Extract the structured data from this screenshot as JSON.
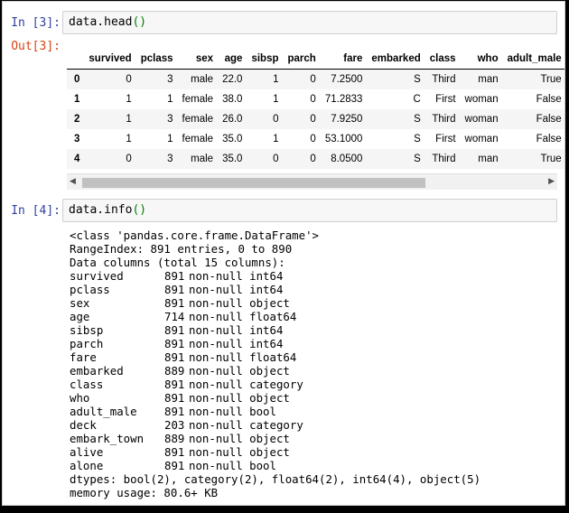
{
  "cells": [
    {
      "prompt_in": "In [3]:",
      "code": "data.head",
      "code_parens": "()",
      "prompt_out": "Out[3]:"
    },
    {
      "prompt_in": "In [4]:",
      "code": "data.info",
      "code_parens": "()"
    }
  ],
  "dataframe": {
    "columns": [
      "",
      "survived",
      "pclass",
      "sex",
      "age",
      "sibsp",
      "parch",
      "fare",
      "embarked",
      "class",
      "who",
      "adult_male"
    ],
    "rows": [
      [
        "0",
        "0",
        "3",
        "male",
        "22.0",
        "1",
        "0",
        "7.2500",
        "S",
        "Third",
        "man",
        "True"
      ],
      [
        "1",
        "1",
        "1",
        "female",
        "38.0",
        "1",
        "0",
        "71.2833",
        "C",
        "First",
        "woman",
        "False"
      ],
      [
        "2",
        "1",
        "3",
        "female",
        "26.0",
        "0",
        "0",
        "7.9250",
        "S",
        "Third",
        "woman",
        "False"
      ],
      [
        "3",
        "1",
        "1",
        "female",
        "35.0",
        "1",
        "0",
        "53.1000",
        "S",
        "First",
        "woman",
        "False"
      ],
      [
        "4",
        "0",
        "3",
        "male",
        "35.0",
        "0",
        "0",
        "8.0500",
        "S",
        "Third",
        "man",
        "True"
      ]
    ]
  },
  "scrollbar": {
    "left_arrow": "◀",
    "right_arrow": "▶"
  },
  "info_output": {
    "header": [
      "<class 'pandas.core.frame.DataFrame'>",
      "RangeIndex: 891 entries, 0 to 890",
      "Data columns (total 15 columns):"
    ],
    "columns": [
      {
        "name": "survived",
        "count": "891",
        "desc": "non-null int64"
      },
      {
        "name": "pclass",
        "count": "891",
        "desc": "non-null int64"
      },
      {
        "name": "sex",
        "count": "891",
        "desc": "non-null object"
      },
      {
        "name": "age",
        "count": "714",
        "desc": "non-null float64"
      },
      {
        "name": "sibsp",
        "count": "891",
        "desc": "non-null int64"
      },
      {
        "name": "parch",
        "count": "891",
        "desc": "non-null int64"
      },
      {
        "name": "fare",
        "count": "891",
        "desc": "non-null float64"
      },
      {
        "name": "embarked",
        "count": "889",
        "desc": "non-null object"
      },
      {
        "name": "class",
        "count": "891",
        "desc": "non-null category"
      },
      {
        "name": "who",
        "count": "891",
        "desc": "non-null object"
      },
      {
        "name": "adult_male",
        "count": "891",
        "desc": "non-null bool"
      },
      {
        "name": "deck",
        "count": "203",
        "desc": "non-null category"
      },
      {
        "name": "embark_town",
        "count": "889",
        "desc": "non-null object"
      },
      {
        "name": "alive",
        "count": "891",
        "desc": "non-null object"
      },
      {
        "name": "alone",
        "count": "891",
        "desc": "non-null bool"
      }
    ],
    "footer": [
      "dtypes: bool(2), category(2), float64(2), int64(4), object(5)",
      "memory usage: 80.6+ KB"
    ]
  }
}
